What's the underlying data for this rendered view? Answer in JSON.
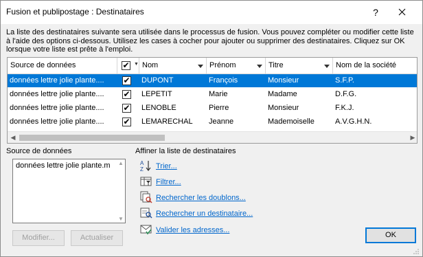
{
  "window": {
    "title": "Fusion et publipostage : Destinataires",
    "help": "?",
    "close": "✕"
  },
  "description": "La liste des destinataires suivante sera utilisée dans le processus de fusion. Vous pouvez compléter ou modifier cette liste à l'aide des options ci-dessous. Utilisez les cases à cocher pour ajouter ou supprimer des destinataires. Cliquez sur OK lorsque votre liste est prête à l'emploi.",
  "table": {
    "headers": [
      "Source de données",
      "",
      "Nom",
      "Prénom",
      "Titre",
      "Nom de la société"
    ],
    "rows": [
      {
        "source": "données lettre jolie plante....",
        "checked": "✔",
        "nom": "DUPONT",
        "prenom": "François",
        "titre": "Monsieur",
        "societe": "S.F.P."
      },
      {
        "source": "données lettre jolie plante....",
        "checked": "✔",
        "nom": "LEPETIT",
        "prenom": "Marie",
        "titre": "Madame",
        "societe": "D.F.G."
      },
      {
        "source": "données lettre jolie plante....",
        "checked": "✔",
        "nom": "LENOBLE",
        "prenom": "Pierre",
        "titre": "Monsieur",
        "societe": "F.K.J."
      },
      {
        "source": "données lettre jolie plante....",
        "checked": "✔",
        "nom": "LEMARECHAL",
        "prenom": "Jeanne",
        "titre": "Mademoiselle",
        "societe": "A.V.G.H.N."
      }
    ]
  },
  "datasource": {
    "label": "Source de données",
    "item": "données lettre jolie plante.m",
    "modify": "Modifier...",
    "refresh": "Actualiser"
  },
  "refine": {
    "label": "Affiner la liste de destinataires",
    "sort": "Trier...",
    "filter": "Filtrer...",
    "duplicates": "Rechercher les doublons...",
    "find": "Rechercher un destinataire...",
    "validate": "Valider les adresses..."
  },
  "ok": "OK",
  "colors": {
    "selection": "#0078d7",
    "link": "#0066cc"
  },
  "icons": {
    "sort": "sort-az-icon",
    "filter": "filter-icon",
    "duplicates": "find-duplicates-icon",
    "find": "find-recipient-icon",
    "validate": "validate-addresses-icon"
  }
}
